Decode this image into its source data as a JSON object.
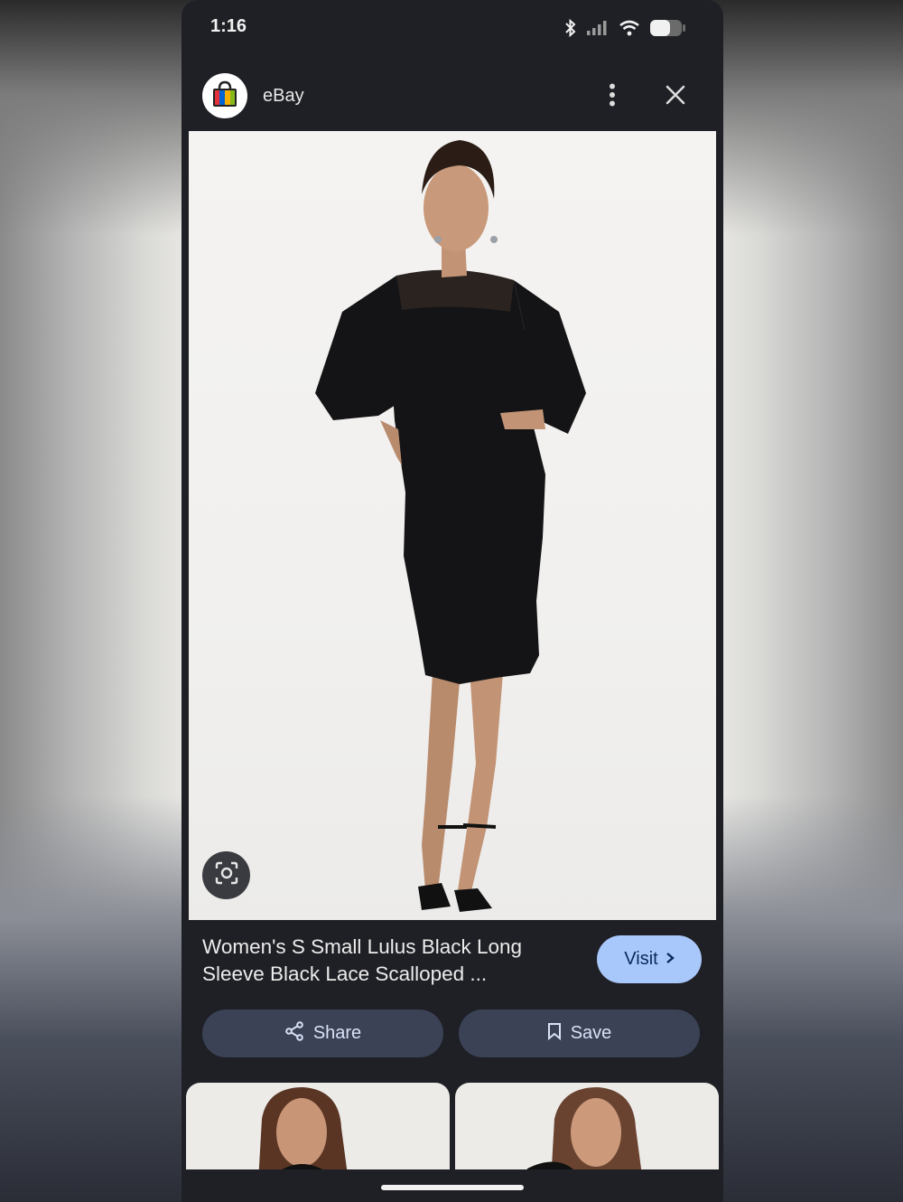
{
  "status_bar": {
    "time": "1:16",
    "icons": [
      "bluetooth-icon",
      "signal-icon",
      "wifi-icon",
      "battery-icon"
    ]
  },
  "header": {
    "source_name": "eBay",
    "logo_icon": "shopping-bag-icon",
    "more_icon": "more-vertical-icon",
    "close_icon": "close-icon"
  },
  "image": {
    "lens_icon": "lens-search-icon"
  },
  "result": {
    "title_line1": "Women's S Small Lulus Black Long",
    "title_line2": "Sleeve Black Lace Scalloped ...",
    "visit_label": "Visit"
  },
  "actions": {
    "share_label": "Share",
    "save_label": "Save"
  },
  "colors": {
    "panel_bg": "#1f2025",
    "visit_bg": "#a8c7fa",
    "action_bg": "#3b4256"
  }
}
